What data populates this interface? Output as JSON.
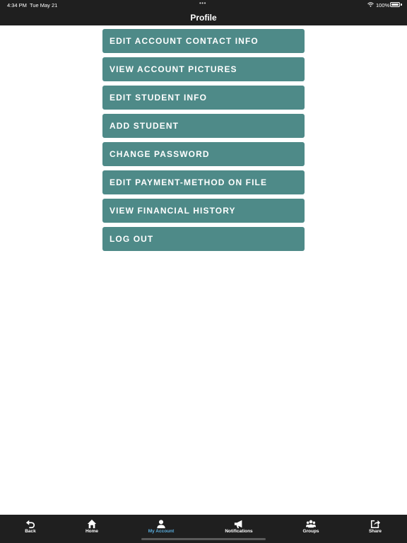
{
  "status_bar": {
    "time": "4:34 PM",
    "date": "Tue May 21",
    "dots": "•••",
    "battery": "100%"
  },
  "header": {
    "title": "Profile"
  },
  "menu": {
    "items": [
      {
        "label": "EDIT ACCOUNT CONTACT INFO"
      },
      {
        "label": "VIEW ACCOUNT PICTURES"
      },
      {
        "label": "EDIT STUDENT INFO"
      },
      {
        "label": "ADD STUDENT"
      },
      {
        "label": "CHANGE PASSWORD"
      },
      {
        "label": "EDIT PAYMENT-METHOD ON FILE"
      },
      {
        "label": "VIEW FINANCIAL HISTORY"
      },
      {
        "label": "LOG OUT"
      }
    ]
  },
  "tab_bar": {
    "tabs": [
      {
        "label": "Back",
        "icon": "back-icon"
      },
      {
        "label": "Home",
        "icon": "home-icon"
      },
      {
        "label": "My Account",
        "icon": "person-icon",
        "active": true
      },
      {
        "label": "Notifications",
        "icon": "megaphone-icon"
      },
      {
        "label": "Groups",
        "icon": "groups-icon"
      },
      {
        "label": "Share",
        "icon": "share-icon"
      }
    ]
  },
  "colors": {
    "bar_background": "#1f1f1f",
    "button": "#4e8a88",
    "active_tab": "#5aaede"
  }
}
